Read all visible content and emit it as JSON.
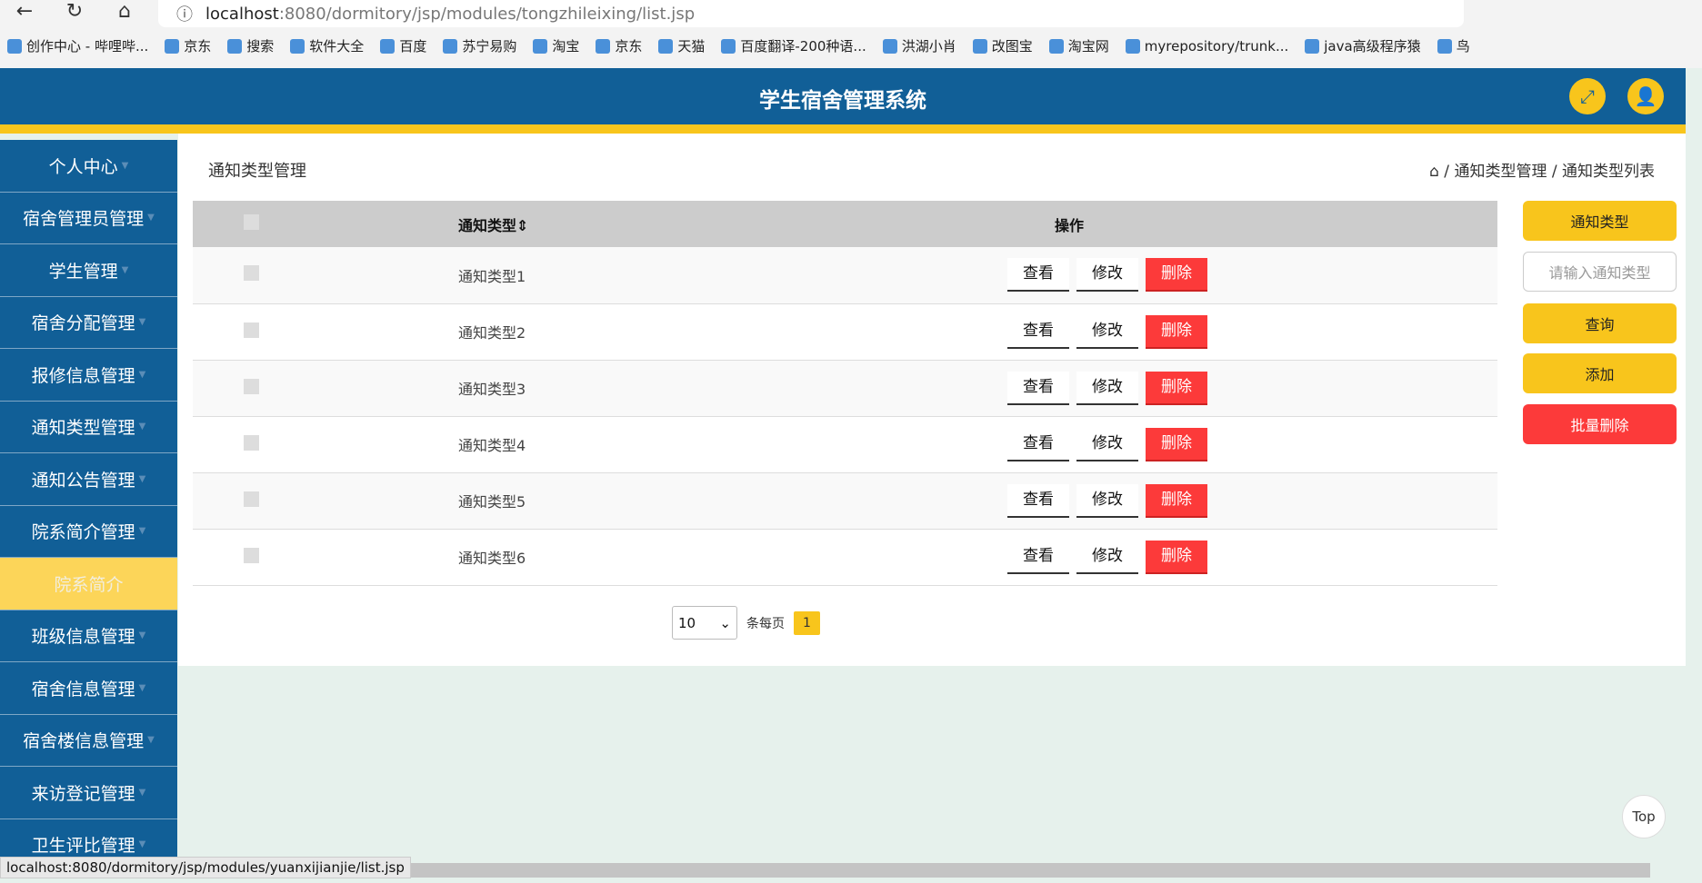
{
  "browser": {
    "url_host": "localhost",
    "url_path": ":8080/dormitory/jsp/modules/tongzhileixing/list.jsp",
    "bookmarks": [
      "创作中心 - 哔哩哔...",
      "京东",
      "搜索",
      "软件大全",
      "百度",
      "苏宁易购",
      "淘宝",
      "京东",
      "天猫",
      "百度翻译-200种语...",
      "洪湖小肖",
      "改图宝",
      "淘宝网",
      "myrepository/trunk...",
      "java高级程序猿",
      "鸟"
    ],
    "status_url": "localhost:8080/dormitory/jsp/modules/yuanxijianjie/list.jsp"
  },
  "header": {
    "title": "学生宿舍管理系统"
  },
  "sidebar": {
    "items": [
      {
        "label": "个人中心"
      },
      {
        "label": "宿舍管理员管理"
      },
      {
        "label": "学生管理"
      },
      {
        "label": "宿舍分配管理"
      },
      {
        "label": "报修信息管理"
      },
      {
        "label": "通知类型管理"
      },
      {
        "label": "通知公告管理"
      },
      {
        "label": "院系简介管理"
      },
      {
        "label": "院系简介",
        "active": true
      },
      {
        "label": "班级信息管理"
      },
      {
        "label": "宿舍信息管理"
      },
      {
        "label": "宿舍楼信息管理"
      },
      {
        "label": "来访登记管理"
      },
      {
        "label": "卫生评比管理"
      }
    ]
  },
  "page": {
    "title": "通知类型管理",
    "breadcrumb": [
      "通知类型管理",
      "通知类型列表"
    ]
  },
  "table": {
    "headers": [
      "通知类型",
      "操作"
    ],
    "rows": [
      "通知类型1",
      "通知类型2",
      "通知类型3",
      "通知类型4",
      "通知类型5",
      "通知类型6"
    ],
    "actions": {
      "view": "查看",
      "edit": "修改",
      "delete": "删除"
    }
  },
  "filters": {
    "label": "通知类型",
    "placeholder": "请输入通知类型",
    "search": "查询",
    "add": "添加",
    "batch_delete": "批量删除"
  },
  "pagination": {
    "page_size": "10",
    "per_page_label": "条每页",
    "current_page": "1"
  },
  "top_label": "Top",
  "colors": {
    "primary": "#115f97",
    "accent": "#f8c51c",
    "danger": "#fc3a3a"
  }
}
